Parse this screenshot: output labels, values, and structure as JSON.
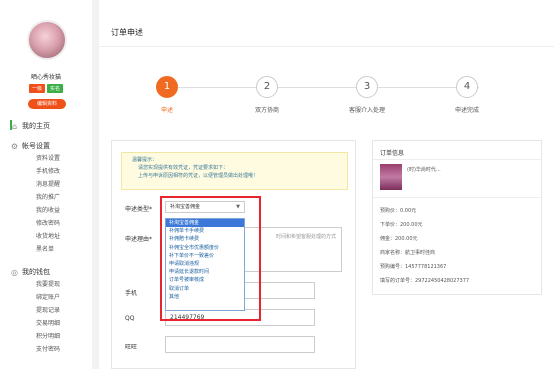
{
  "sidebar": {
    "username": "晒心秀妆猫",
    "level_badge": "一级",
    "verify_badge": "实名",
    "edit_button": "编辑资料",
    "nav_home": "我的主页",
    "account": {
      "title": "帐号设置",
      "items": [
        "资料设置",
        "手机修改",
        "消息提醒",
        "我的推广",
        "我的收益",
        "修改密码",
        "收货地址",
        "黑名单"
      ]
    },
    "wallet": {
      "title": "我的钱包",
      "items": [
        "我要提现",
        "绑定账户",
        "提现记录",
        "交易明细",
        "积分明细",
        "支付密码"
      ]
    }
  },
  "main": {
    "title": "订单申述",
    "steps": [
      {
        "num": "1",
        "label": "申述"
      },
      {
        "num": "2",
        "label": "双方协商"
      },
      {
        "num": "3",
        "label": "客服介入处理"
      },
      {
        "num": "4",
        "label": "申述完成"
      }
    ],
    "active_step": 0
  },
  "form": {
    "notice_title": "温馨提示：",
    "notice_line1": "请您实现提供有效凭证，凭证要求如下：",
    "notice_line2": "上传与申诉原因相符的凭证，以便管理员做出处理哦！",
    "type_label": "申述类型*",
    "type_selected": "补淘宝善佣金",
    "reason_label": "申述理由*",
    "reason_placeholder": "时间和希望客服处理的方式",
    "phone_label": "手机",
    "phone_value": "",
    "qq_label": "QQ",
    "qq_value": "214497769",
    "wangwang_label": "旺旺",
    "wangwang_value": "",
    "dropdown_options": [
      "补淘宝善佣金",
      "补佣单卡手续费",
      "补佣赔卡续费",
      "补佣宝全市优惠额度价",
      "补下单价不一致差价",
      "申请取消违规",
      "申请延长退款时间",
      "订单号被审核成",
      "取消订单",
      "其他"
    ]
  },
  "order_info": {
    "title": "订单信息",
    "product": "(时)华尚时代...",
    "lines": [
      "预购价：0.00元",
      "下单价：200.00元",
      "佣金：200.00元",
      "商家名称：航卫事时佳商",
      "预购编号：1457778121367",
      "填写的订单号：29722450428027377"
    ]
  },
  "colors": {
    "accent": "#f06a22",
    "brand_green": "#3bae47",
    "highlight": "#e8252d",
    "selected": "#3b78d8"
  }
}
